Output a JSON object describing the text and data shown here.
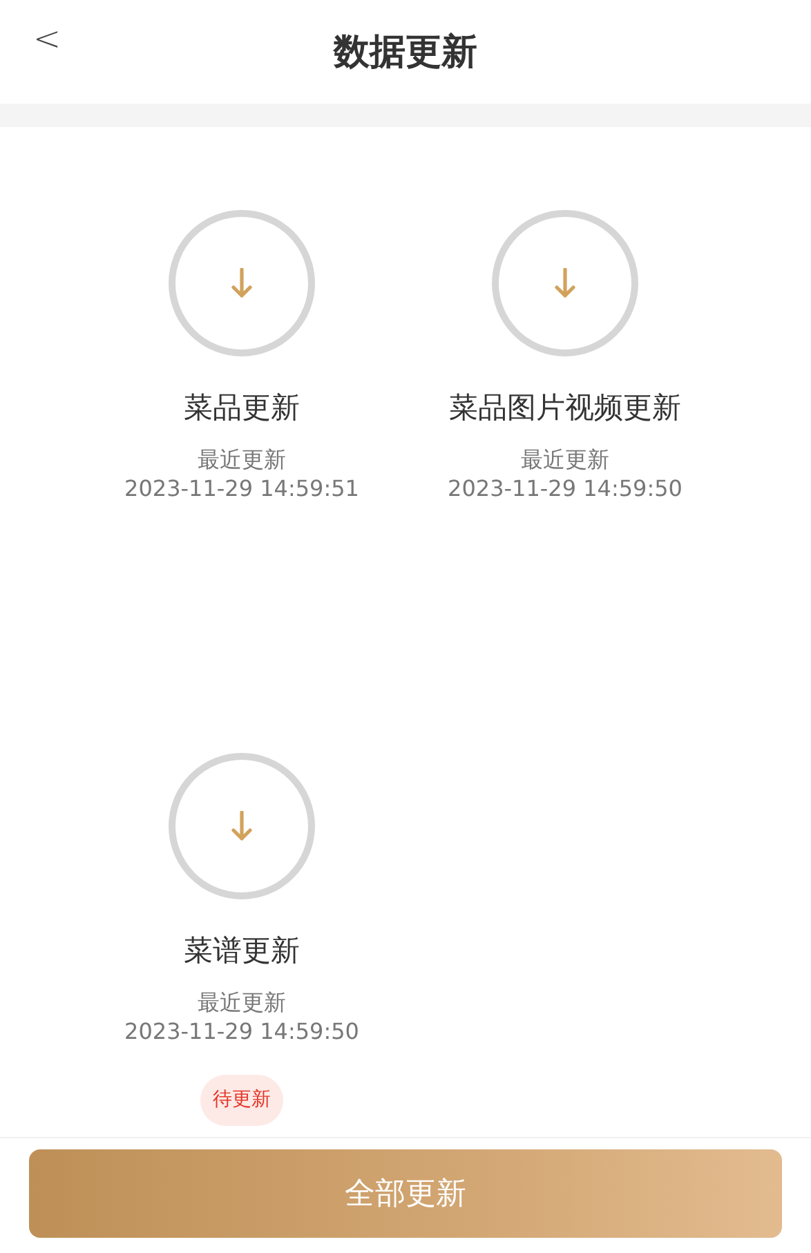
{
  "header": {
    "back": "<",
    "title": "数据更新"
  },
  "items": [
    {
      "name": "菜品更新",
      "label": "最近更新",
      "time": "2023-11-29 14:59:51",
      "pending": false
    },
    {
      "name": "菜品图片视频更新",
      "label": "最近更新",
      "time": "2023-11-29 14:59:50",
      "pending": false
    },
    {
      "name": "菜谱更新",
      "label": "最近更新",
      "time": "2023-11-29 14:59:50",
      "pending": true,
      "badge": "待更新"
    }
  ],
  "button": "全部更新"
}
